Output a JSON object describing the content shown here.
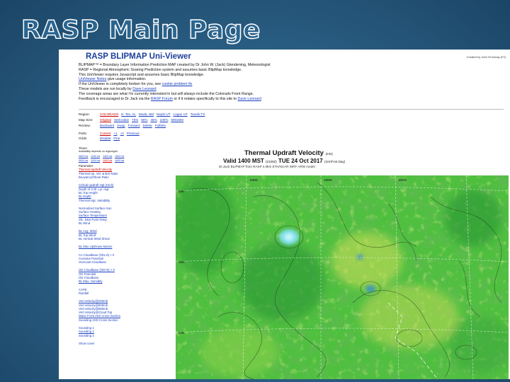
{
  "slide": {
    "title": "RASP Main Page"
  },
  "app": {
    "title": "RASP BLIPMAP Uni-Viewer",
    "credit": "Created by John W.Ichnay (F2)",
    "intro": {
      "line1": "BLIPMAP™ = Boundary Layer Information Prediction MAP created by Dr John W. (Jack) Glendening, Meteorologist",
      "line2": "RASP = Regional Atmospheric Soaring Prediction system and assumes basic BlipMap knowledge.",
      "line3": "This UniViewer requires Javascript and assumes basic BlipMap knowledge.",
      "line4_link": "UniViewer Notes",
      "line4_rest": " give usage information.",
      "line5_pre": "If the UniViewer is completely broken for you, see ",
      "line5_link": "cookie problem fix",
      "line6_pre": "These models are run locally by ",
      "line6_link": "Dave Leonard",
      "line7": "The coverage areas are what I'm currently interested in but will always include the Colorado Front Range.",
      "line8_pre": "Feedback is encouraged to Dr Jack via the ",
      "line8_link": "RASP Forum",
      "line8_rest": " or if it relates specifically to this site to ",
      "line8_link2": "Dave Leonard"
    },
    "controls": {
      "region": {
        "label": "Region:",
        "options": [
          "COLORADO",
          "E. Tex. AL",
          "Moab, NM",
          "Nephi UT",
          "Logan UT",
          "Tooele TX"
        ],
        "selected": "COLORADO"
      },
      "mapsize": {
        "label": "Map Size:",
        "options": [
          "Original",
          "SetCookie",
          "75%",
          "90%",
          "45%",
          "100%",
          "800x600"
        ],
        "selected": "Original"
      },
      "review": {
        "label": "ReView:",
        "options": [
          "Backward",
          "Swap",
          "Forward",
          "Delete",
          "FullWin"
        ]
      },
      "parts": {
        "label": "Parts:",
        "options": [
          "Current",
          "+1",
          "+2",
          "Previous"
        ],
        "selected": "Current"
      },
      "grids": {
        "label": "Grids:",
        "options": [
          "Disable",
          "Fine"
        ]
      }
    },
    "times": {
      "label": "Times:",
      "note": "Availability depends on region/grid",
      "values": [
        "0800 lst",
        "1100 lst",
        "1300 lst",
        "1500 lst",
        "0900 lst",
        "1200 lst",
        "1400 lst",
        "1600 lst"
      ],
      "selected": "1400 lst"
    },
    "menu": {
      "parameter_head": "Parameter:",
      "groups": [
        [
          "Thermal Updraft Velocity",
          "Thermal Up. Vel. & B/S Ratio",
          "Buoyancy/Shear Ratio"
        ],
        [
          "Critical Updraft Hgt (Hcrit)",
          "Depth of Critl. Lyr. Hgt.",
          "BL Top Height",
          "BL Depth",
          "Thermal Hgt. Variability"
        ],
        [
          "Normalized Surface Sun",
          "Surface Heating",
          "Surface Temperature",
          "Sfc. Dew Point Temp.",
          "BL Wind"
        ],
        [
          "BL Avg. Wind",
          "BL Top Wind",
          "BL Vertical Wind Shear"
        ],
        [
          "BL Max Up/Down Motion"
        ],
        [
          "Cu Cloudbase (SfcLvl) > 0",
          "Cumulus Potential",
          "Overcast Cloudbase"
        ],
        [
          "OD Cloudbase (OD>0) > 0",
          "OD Potential",
          "OD Cloudbase",
          "BL Max. Humidity"
        ],
        [
          "CAPE",
          "Rainfall"
        ],
        [
          "Vert.Velocity@200mb",
          "Vert.Velocity@500mb",
          "Vert.Velocity@850mb",
          "Vert.Velocity@Cloud Top",
          "Wave Front 2XZ Cross Section",
          "Sounding 2XD Cross Section"
        ],
        [
          "Sounding 1",
          "Sounding 2",
          "Sounding 3"
        ],
        [
          "Show cover"
        ]
      ]
    },
    "plot": {
      "title": "Thermal Updraft Velocity",
      "title_units": "(m/s)",
      "valid": "Valid 1400 MST",
      "valid_mid": "(2100Z)",
      "valid_day": "TUE 24 Oct 2017",
      "valid_suffix": "(1Hr/Fcst Day)",
      "source": "Dr.Jack BLIPMAP from RASP 4.0km ETA/NCAR WRF ARW model",
      "lat_labels": [
        "34N",
        "36N",
        "38N"
      ],
      "lon_labels": [
        "108W",
        "106W",
        "104W"
      ]
    },
    "colors": {
      "slide_bg": "#2c6288",
      "slide_title": "#2a6590",
      "link": "#1a3fbf",
      "selected": "#cc0000",
      "map_green": "#4fbf3f",
      "map_dark": "#248a2a",
      "map_yellow": "#d8e25a",
      "map_cyan": "#7fe0e8"
    }
  }
}
